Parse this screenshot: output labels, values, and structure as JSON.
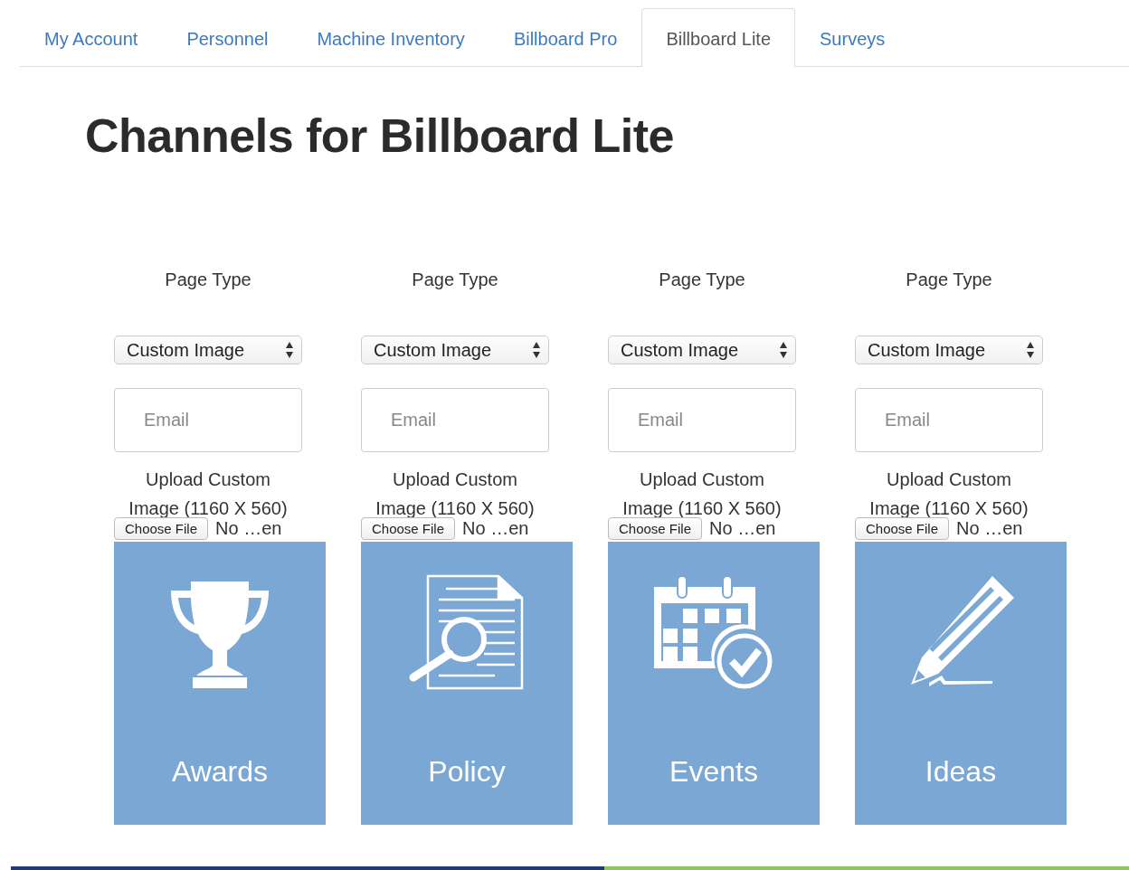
{
  "tabs": [
    {
      "label": "My Account",
      "selected": false
    },
    {
      "label": "Personnel",
      "selected": false
    },
    {
      "label": "Machine Inventory",
      "selected": false
    },
    {
      "label": "Billboard Pro",
      "selected": false
    },
    {
      "label": "Billboard Lite",
      "selected": true
    },
    {
      "label": "Surveys",
      "selected": false
    }
  ],
  "heading": "Channels for Billboard Lite",
  "channels": [
    {
      "page_type_label": "Page Type",
      "page_type": "Custom Image",
      "email_placeholder": "Email",
      "upload_label": "Upload Custom Image (1160 X 560)",
      "choose_file": "Choose File",
      "file_status": "No …en",
      "tile": {
        "label": "Awards",
        "kind": "trophy"
      }
    },
    {
      "page_type_label": "Page Type",
      "page_type": "Custom Image",
      "email_placeholder": "Email",
      "upload_label": "Upload Custom Image (1160 X 560)",
      "choose_file": "Choose File",
      "file_status": "No …en",
      "tile": {
        "label": "Policy",
        "kind": "document"
      }
    },
    {
      "page_type_label": "Page Type",
      "page_type": "Custom Image",
      "email_placeholder": "Email",
      "upload_label": "Upload Custom Image (1160 X 560)",
      "choose_file": "Choose File",
      "file_status": "No …en",
      "tile": {
        "label": "Events",
        "kind": "calendar"
      }
    },
    {
      "page_type_label": "Page Type",
      "page_type": "Custom Image",
      "email_placeholder": "Email",
      "upload_label": "Upload Custom Image (1160 X 560)",
      "choose_file": "Choose File",
      "file_status": "No …en",
      "tile": {
        "label": "Ideas",
        "kind": "pencil"
      }
    }
  ]
}
